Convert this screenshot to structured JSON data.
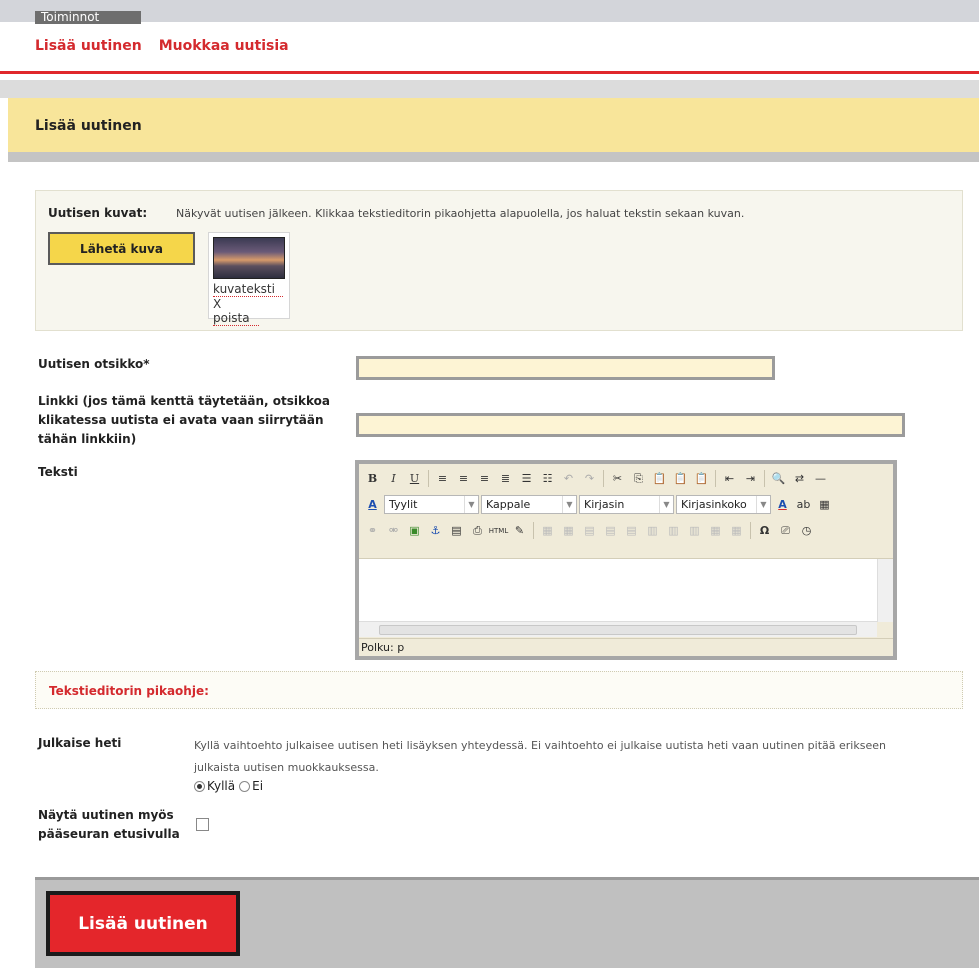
{
  "topbar": {
    "tab_label": "Toiminnot"
  },
  "subnav": {
    "add_news": "Lisää uutinen",
    "edit_news": "Muokkaa uutisia"
  },
  "header": {
    "title": "Lisää uutinen"
  },
  "images": {
    "label": "Uutisen kuvat:",
    "note": "Näkyvät uutisen jälkeen. Klikkaa tekstieditorin pikaohjetta alapuolella, jos haluat tekstin sekaan kuvan.",
    "send_button": "Lähetä kuva",
    "thumb_caption": "kuvateksti",
    "thumb_remove": "X poista"
  },
  "form": {
    "title_label": "Uutisen otsikko*",
    "title_value": "",
    "link_label": "Linkki (jos tämä kenttä täytetään, otsikkoa klikatessa uutista ei avata vaan siirrytään tähän linkkiin)",
    "link_value": "",
    "text_label": "Teksti"
  },
  "editor": {
    "select_styles": "Tyylit",
    "select_format": "Kappale",
    "select_font": "Kirjasin",
    "select_size": "Kirjasinkoko",
    "path_label": "Polku: p"
  },
  "help": {
    "title": "Tekstieditorin pikaohje:"
  },
  "publish": {
    "label": "Julkaise heti",
    "description": "Kyllä vaihtoehto julkaisee uutisen heti lisäyksen yhteydessä. Ei vaihtoehto ei julkaise uutista heti vaan uutinen pitää erikseen julkaista uutisen muokkauksessa.",
    "option_yes": "Kyllä",
    "option_no": "Ei",
    "selected": "Kyllä"
  },
  "frontpage": {
    "label": "Näytä uutinen myös pääseuran etusivulla",
    "checked": false
  },
  "submit": {
    "label": "Lisää uutinen"
  }
}
